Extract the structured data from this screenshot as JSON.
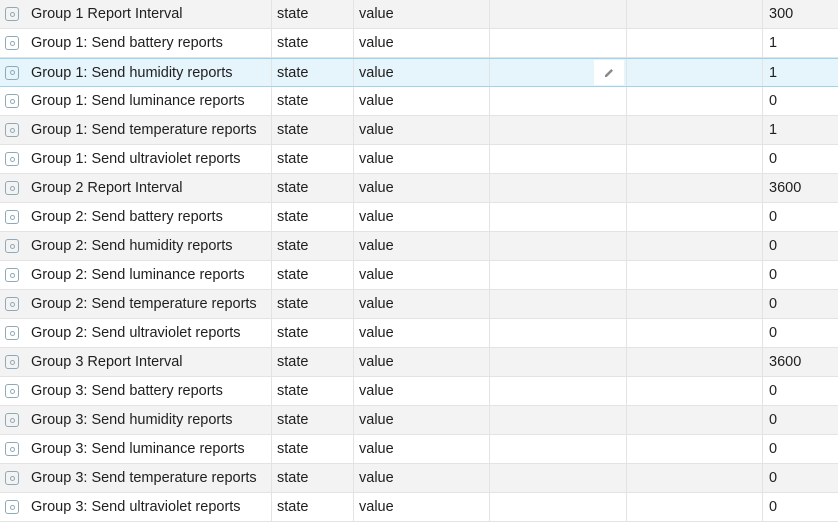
{
  "rows": [
    {
      "name": "Group 1 Report Interval",
      "type": "state",
      "role": "value",
      "value": "300"
    },
    {
      "name": "Group 1: Send battery reports",
      "type": "state",
      "role": "value",
      "value": "1"
    },
    {
      "name": "Group 1: Send humidity reports",
      "type": "state",
      "role": "value",
      "value": "1",
      "selected": true
    },
    {
      "name": "Group 1: Send luminance reports",
      "type": "state",
      "role": "value",
      "value": "0"
    },
    {
      "name": "Group 1: Send temperature reports",
      "type": "state",
      "role": "value",
      "value": "1"
    },
    {
      "name": "Group 1: Send ultraviolet reports",
      "type": "state",
      "role": "value",
      "value": "0"
    },
    {
      "name": "Group 2 Report Interval",
      "type": "state",
      "role": "value",
      "value": "3600"
    },
    {
      "name": "Group 2: Send battery reports",
      "type": "state",
      "role": "value",
      "value": "0"
    },
    {
      "name": "Group 2: Send humidity reports",
      "type": "state",
      "role": "value",
      "value": "0"
    },
    {
      "name": "Group 2: Send luminance reports",
      "type": "state",
      "role": "value",
      "value": "0"
    },
    {
      "name": "Group 2: Send temperature reports",
      "type": "state",
      "role": "value",
      "value": "0"
    },
    {
      "name": "Group 2: Send ultraviolet reports",
      "type": "state",
      "role": "value",
      "value": "0"
    },
    {
      "name": "Group 3 Report Interval",
      "type": "state",
      "role": "value",
      "value": "3600"
    },
    {
      "name": "Group 3: Send battery reports",
      "type": "state",
      "role": "value",
      "value": "0"
    },
    {
      "name": "Group 3: Send humidity reports",
      "type": "state",
      "role": "value",
      "value": "0"
    },
    {
      "name": "Group 3: Send luminance reports",
      "type": "state",
      "role": "value",
      "value": "0"
    },
    {
      "name": "Group 3: Send temperature reports",
      "type": "state",
      "role": "value",
      "value": "0"
    },
    {
      "name": "Group 3: Send ultraviolet reports",
      "type": "state",
      "role": "value",
      "value": "0"
    }
  ],
  "icons": {
    "row": "state-object-icon",
    "edit": "pencil-edit-icon"
  },
  "colors": {
    "selected_row_bg": "#e6f4fb",
    "selected_row_border": "#9fd3ee",
    "alt_row_bg": "#f3f3f3"
  }
}
